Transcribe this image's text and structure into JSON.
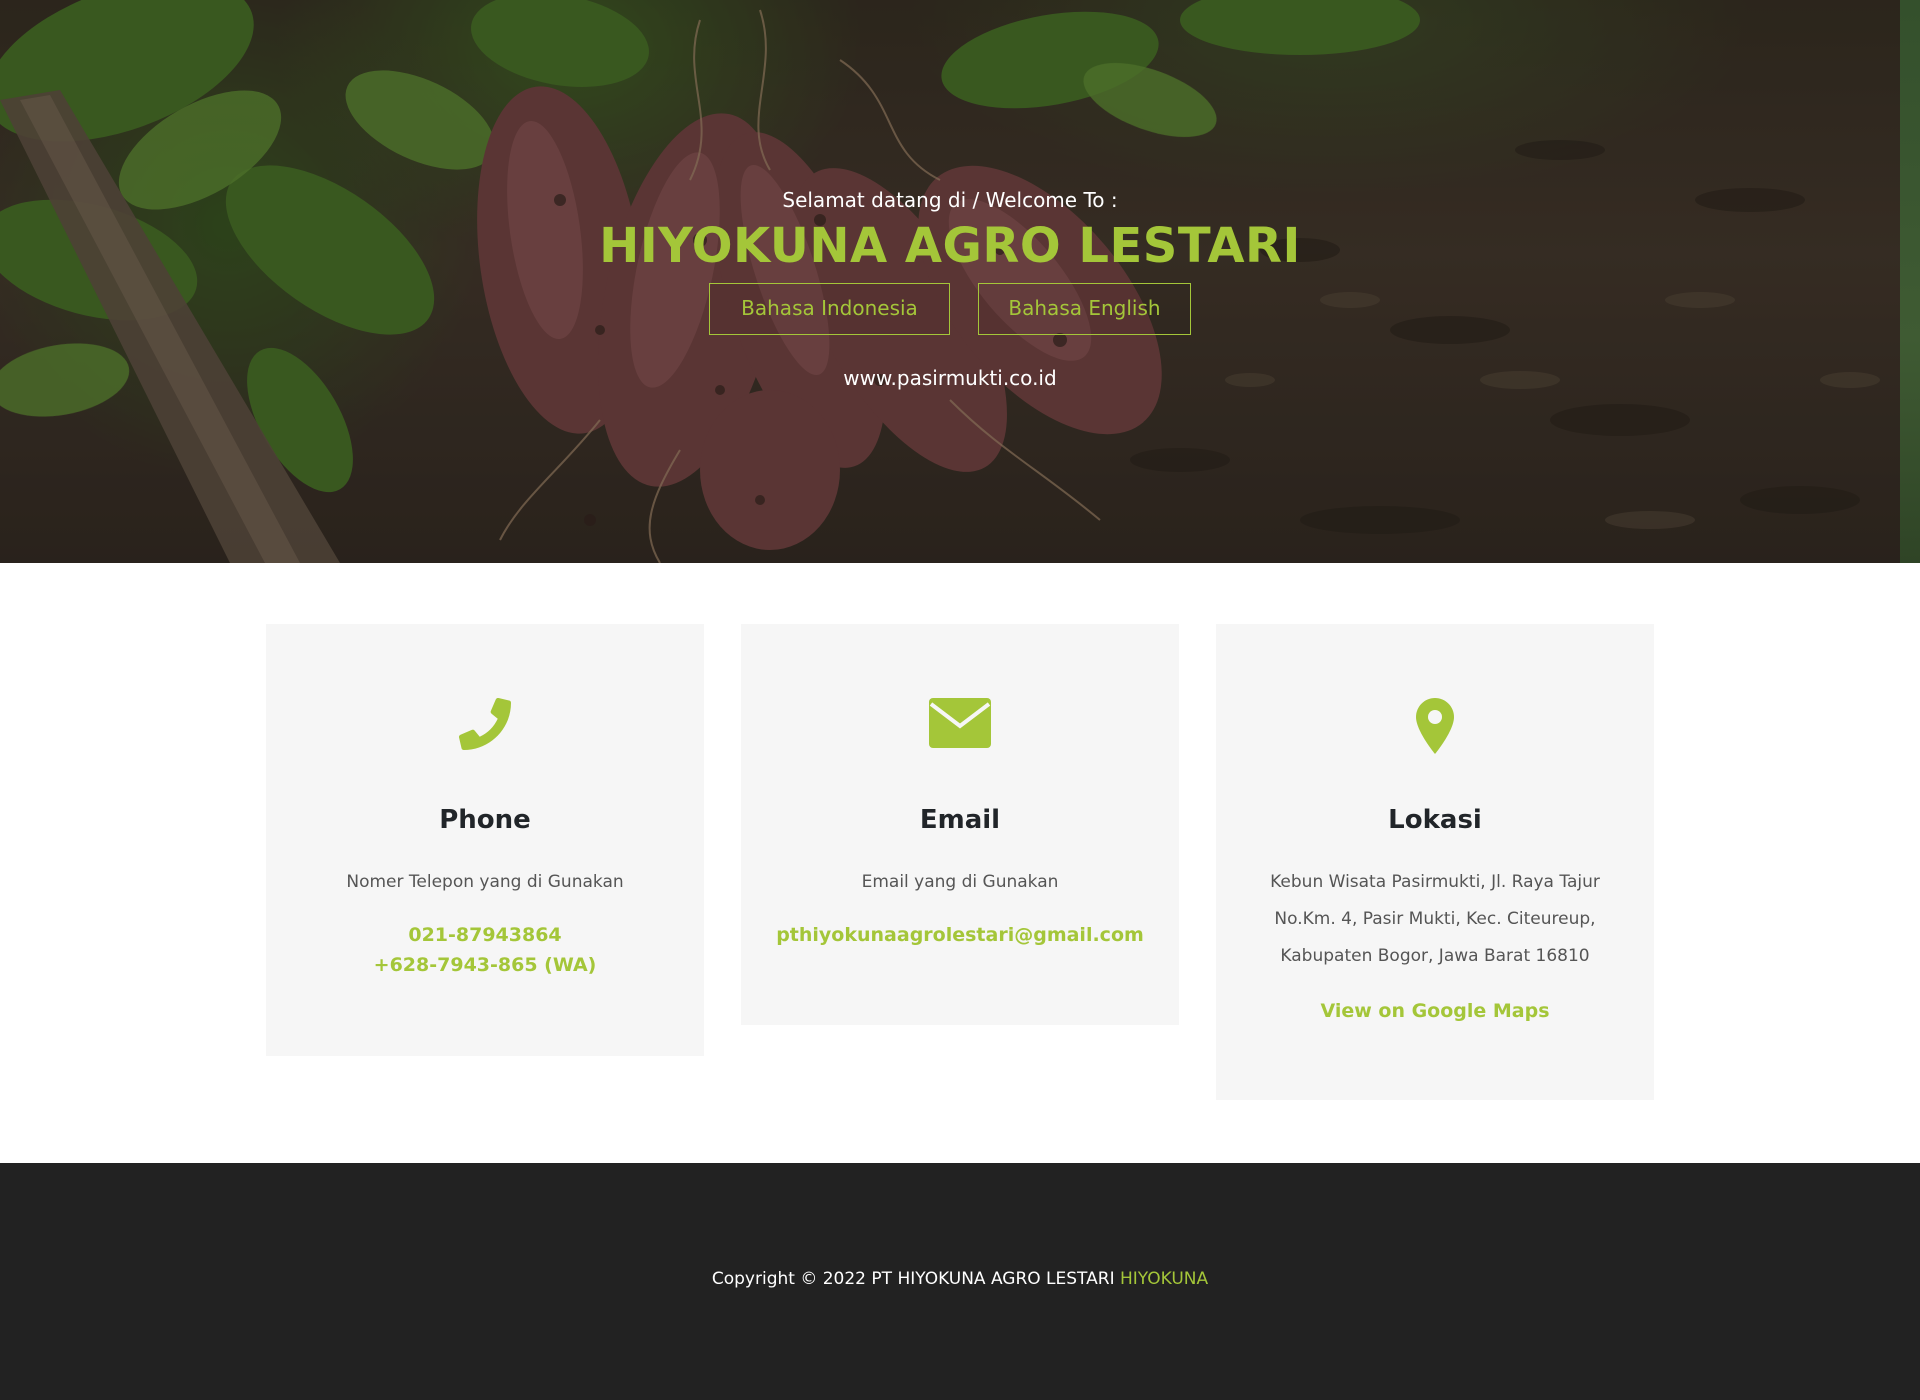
{
  "hero": {
    "welcome_text": "Selamat datang di / Welcome To :",
    "title": "HIYOKUNA AGRO LESTARI",
    "buttons": {
      "indonesia": "Bahasa Indonesia",
      "english": "Bahasa English"
    },
    "website": "www.pasirmukti.co.id",
    "background_image": "sweet-potatoes-in-soil"
  },
  "contacts": {
    "phone": {
      "icon": "phone-icon",
      "title": "Phone",
      "description": "Nomer Telepon yang di Gunakan",
      "numbers": [
        "021-87943864",
        "+628-7943-865 (WA)"
      ]
    },
    "email": {
      "icon": "envelope-icon",
      "title": "Email",
      "description": "Email yang di Gunakan",
      "address": "pthiyokunaagrolestari@gmail.com"
    },
    "location": {
      "icon": "map-pin-icon",
      "title": "Lokasi",
      "address": "Kebun Wisata Pasirmukti, Jl. Raya Tajur No.Km. 4, Pasir Mukti, Kec. Citeureup, Kabupaten Bogor, Jawa Barat 16810",
      "maps_link": "View on Google Maps"
    }
  },
  "footer": {
    "copyright": "Copyright © 2022 PT HIYOKUNA AGRO LESTARI",
    "brand": "HIYOKUNA"
  },
  "colors": {
    "accent": "#a4c639",
    "card_background": "#f6f6f6",
    "footer_background": "#222222"
  }
}
